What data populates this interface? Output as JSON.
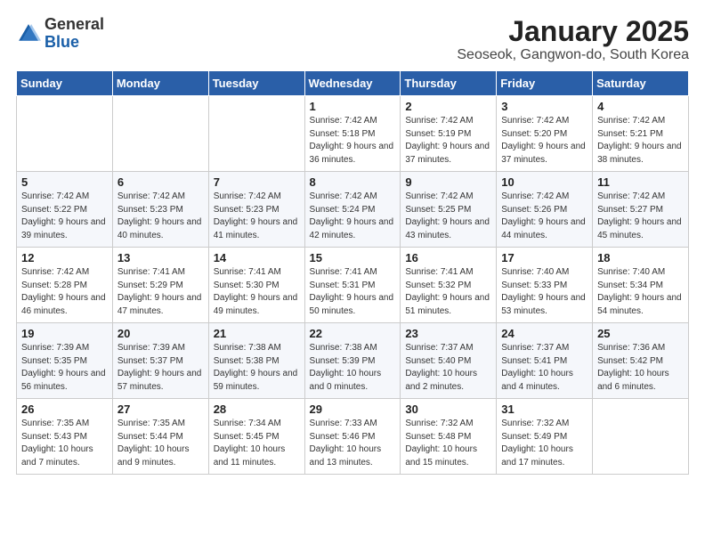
{
  "logo": {
    "general": "General",
    "blue": "Blue"
  },
  "title": "January 2025",
  "subtitle": "Seoseok, Gangwon-do, South Korea",
  "days_of_week": [
    "Sunday",
    "Monday",
    "Tuesday",
    "Wednesday",
    "Thursday",
    "Friday",
    "Saturday"
  ],
  "weeks": [
    [
      {
        "day": "",
        "content": ""
      },
      {
        "day": "",
        "content": ""
      },
      {
        "day": "",
        "content": ""
      },
      {
        "day": "1",
        "content": "Sunrise: 7:42 AM\nSunset: 5:18 PM\nDaylight: 9 hours\nand 36 minutes."
      },
      {
        "day": "2",
        "content": "Sunrise: 7:42 AM\nSunset: 5:19 PM\nDaylight: 9 hours\nand 37 minutes."
      },
      {
        "day": "3",
        "content": "Sunrise: 7:42 AM\nSunset: 5:20 PM\nDaylight: 9 hours\nand 37 minutes."
      },
      {
        "day": "4",
        "content": "Sunrise: 7:42 AM\nSunset: 5:21 PM\nDaylight: 9 hours\nand 38 minutes."
      }
    ],
    [
      {
        "day": "5",
        "content": "Sunrise: 7:42 AM\nSunset: 5:22 PM\nDaylight: 9 hours\nand 39 minutes."
      },
      {
        "day": "6",
        "content": "Sunrise: 7:42 AM\nSunset: 5:23 PM\nDaylight: 9 hours\nand 40 minutes."
      },
      {
        "day": "7",
        "content": "Sunrise: 7:42 AM\nSunset: 5:23 PM\nDaylight: 9 hours\nand 41 minutes."
      },
      {
        "day": "8",
        "content": "Sunrise: 7:42 AM\nSunset: 5:24 PM\nDaylight: 9 hours\nand 42 minutes."
      },
      {
        "day": "9",
        "content": "Sunrise: 7:42 AM\nSunset: 5:25 PM\nDaylight: 9 hours\nand 43 minutes."
      },
      {
        "day": "10",
        "content": "Sunrise: 7:42 AM\nSunset: 5:26 PM\nDaylight: 9 hours\nand 44 minutes."
      },
      {
        "day": "11",
        "content": "Sunrise: 7:42 AM\nSunset: 5:27 PM\nDaylight: 9 hours\nand 45 minutes."
      }
    ],
    [
      {
        "day": "12",
        "content": "Sunrise: 7:42 AM\nSunset: 5:28 PM\nDaylight: 9 hours\nand 46 minutes."
      },
      {
        "day": "13",
        "content": "Sunrise: 7:41 AM\nSunset: 5:29 PM\nDaylight: 9 hours\nand 47 minutes."
      },
      {
        "day": "14",
        "content": "Sunrise: 7:41 AM\nSunset: 5:30 PM\nDaylight: 9 hours\nand 49 minutes."
      },
      {
        "day": "15",
        "content": "Sunrise: 7:41 AM\nSunset: 5:31 PM\nDaylight: 9 hours\nand 50 minutes."
      },
      {
        "day": "16",
        "content": "Sunrise: 7:41 AM\nSunset: 5:32 PM\nDaylight: 9 hours\nand 51 minutes."
      },
      {
        "day": "17",
        "content": "Sunrise: 7:40 AM\nSunset: 5:33 PM\nDaylight: 9 hours\nand 53 minutes."
      },
      {
        "day": "18",
        "content": "Sunrise: 7:40 AM\nSunset: 5:34 PM\nDaylight: 9 hours\nand 54 minutes."
      }
    ],
    [
      {
        "day": "19",
        "content": "Sunrise: 7:39 AM\nSunset: 5:35 PM\nDaylight: 9 hours\nand 56 minutes."
      },
      {
        "day": "20",
        "content": "Sunrise: 7:39 AM\nSunset: 5:37 PM\nDaylight: 9 hours\nand 57 minutes."
      },
      {
        "day": "21",
        "content": "Sunrise: 7:38 AM\nSunset: 5:38 PM\nDaylight: 9 hours\nand 59 minutes."
      },
      {
        "day": "22",
        "content": "Sunrise: 7:38 AM\nSunset: 5:39 PM\nDaylight: 10 hours\nand 0 minutes."
      },
      {
        "day": "23",
        "content": "Sunrise: 7:37 AM\nSunset: 5:40 PM\nDaylight: 10 hours\nand 2 minutes."
      },
      {
        "day": "24",
        "content": "Sunrise: 7:37 AM\nSunset: 5:41 PM\nDaylight: 10 hours\nand 4 minutes."
      },
      {
        "day": "25",
        "content": "Sunrise: 7:36 AM\nSunset: 5:42 PM\nDaylight: 10 hours\nand 6 minutes."
      }
    ],
    [
      {
        "day": "26",
        "content": "Sunrise: 7:35 AM\nSunset: 5:43 PM\nDaylight: 10 hours\nand 7 minutes."
      },
      {
        "day": "27",
        "content": "Sunrise: 7:35 AM\nSunset: 5:44 PM\nDaylight: 10 hours\nand 9 minutes."
      },
      {
        "day": "28",
        "content": "Sunrise: 7:34 AM\nSunset: 5:45 PM\nDaylight: 10 hours\nand 11 minutes."
      },
      {
        "day": "29",
        "content": "Sunrise: 7:33 AM\nSunset: 5:46 PM\nDaylight: 10 hours\nand 13 minutes."
      },
      {
        "day": "30",
        "content": "Sunrise: 7:32 AM\nSunset: 5:48 PM\nDaylight: 10 hours\nand 15 minutes."
      },
      {
        "day": "31",
        "content": "Sunrise: 7:32 AM\nSunset: 5:49 PM\nDaylight: 10 hours\nand 17 minutes."
      },
      {
        "day": "",
        "content": ""
      }
    ]
  ]
}
